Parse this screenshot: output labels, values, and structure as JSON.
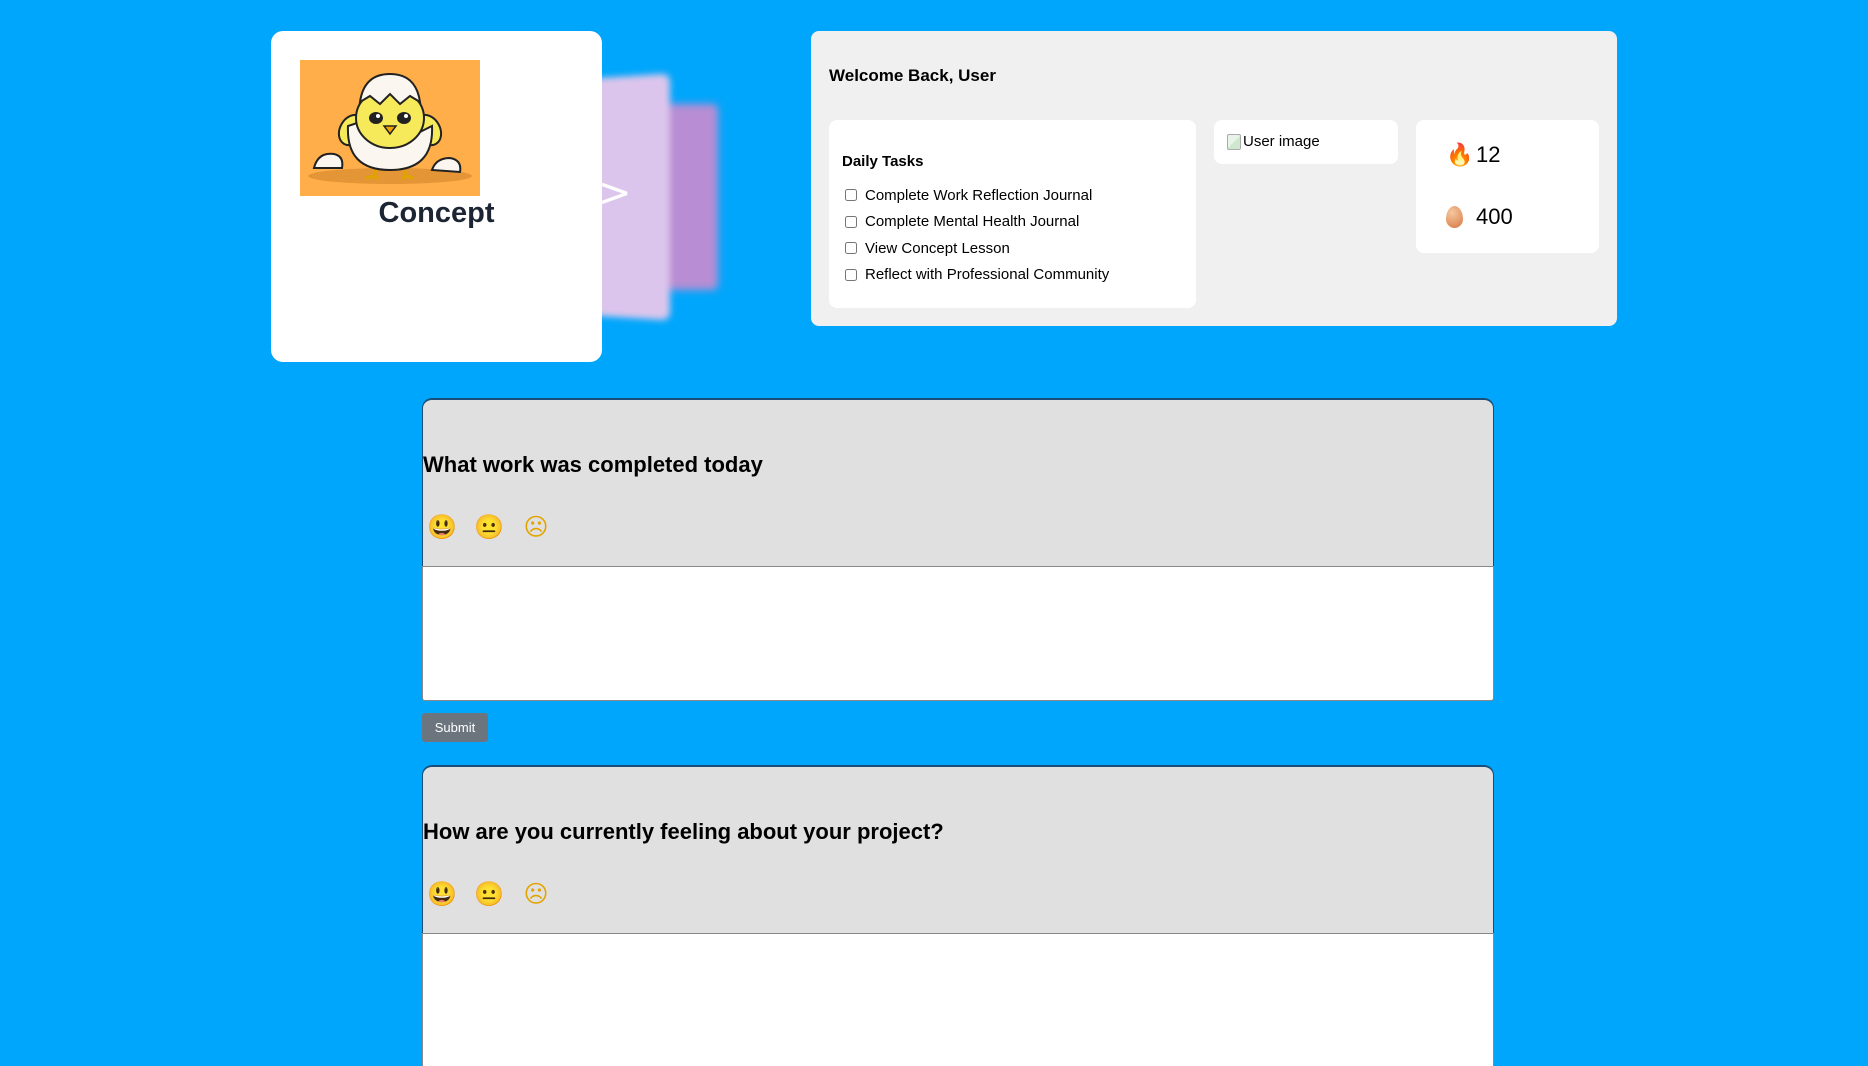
{
  "concept_carousel": {
    "title": "Concept",
    "next_arrow": ">"
  },
  "dashboard": {
    "welcome": "Welcome Back, User",
    "daily_tasks": {
      "title": "Daily Tasks",
      "items": [
        {
          "label": "Complete Work Reflection Journal",
          "checked": false
        },
        {
          "label": "Complete Mental Health Journal",
          "checked": false
        },
        {
          "label": "View Concept Lesson",
          "checked": false
        },
        {
          "label": "Reflect with Professional Community",
          "checked": false
        }
      ]
    },
    "user_image_alt": "User image",
    "stats": {
      "streak_icon": "fire-icon",
      "streak": "12",
      "eggs_icon": "egg-icon",
      "eggs": "400"
    }
  },
  "journals": [
    {
      "question": "What work was completed today",
      "moods": [
        "😃",
        "😐",
        "☹"
      ],
      "input_value": "",
      "submit_label": "Submit"
    },
    {
      "question": "How are you currently feeling about your project?",
      "moods": [
        "😃",
        "😐",
        "☹"
      ],
      "input_value": ""
    }
  ],
  "colors": {
    "background": "#00a6fb",
    "panel": "#f0f0f0",
    "journal_header": "#e0e0e0",
    "submit_button": "#6c757d"
  }
}
